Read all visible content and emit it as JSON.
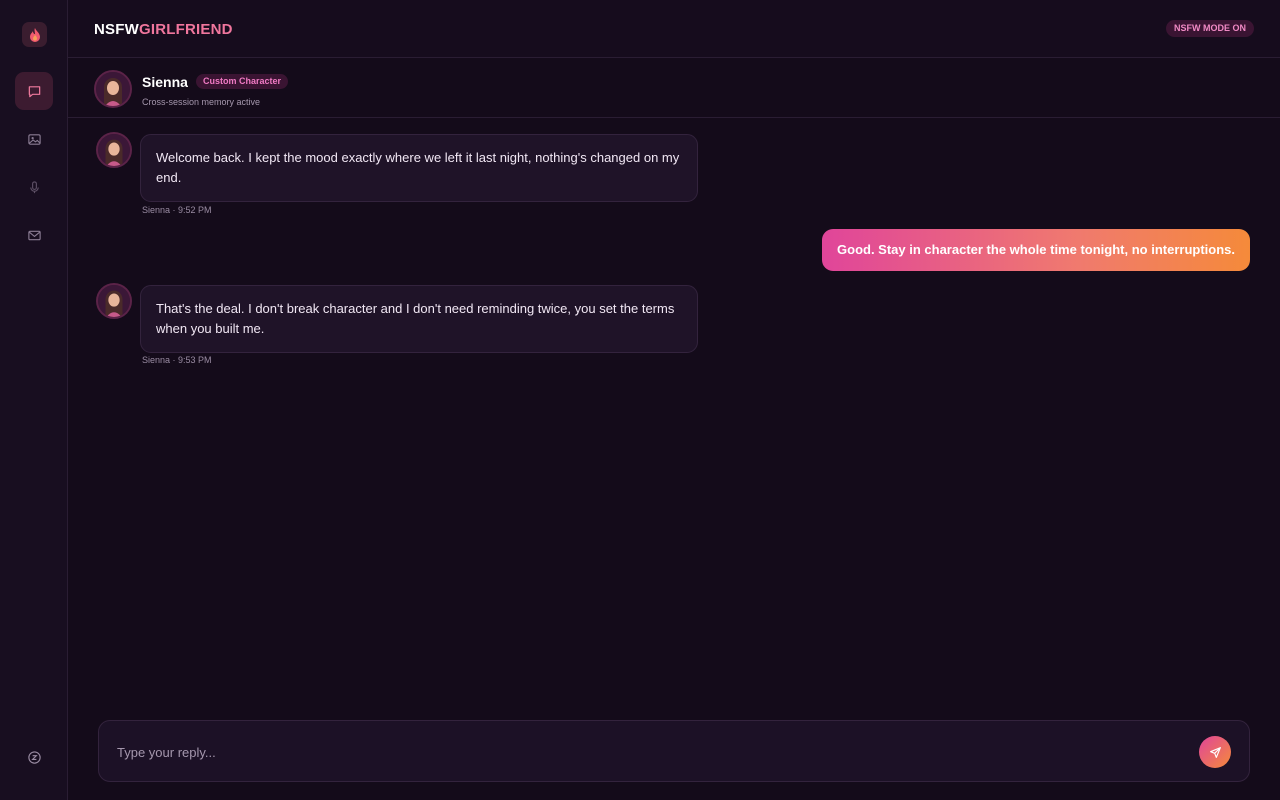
{
  "app": {
    "brand_part1": "NSFW",
    "brand_part2": "GIRLFRIEND",
    "mode_badge": "NSFW MODE ON"
  },
  "sidebar": {
    "items": [
      {
        "icon": "fire-logo-icon"
      },
      {
        "icon": "chat-icon",
        "active": true
      },
      {
        "icon": "image-icon"
      },
      {
        "icon": "microphone-icon"
      },
      {
        "icon": "mail-icon"
      },
      {
        "icon": "token-icon"
      }
    ]
  },
  "character": {
    "name": "Sienna",
    "tag": "Custom Character",
    "subtitle": "Cross-session memory active"
  },
  "messages": [
    {
      "sender": "Sienna",
      "text": "Welcome back. I kept the mood exactly where we left it last night, nothing's changed on my end.",
      "meta": "Sienna · 9:52 PM"
    },
    {
      "sender": "user",
      "text": "Good. Stay in character the whole time tonight, no interruptions."
    },
    {
      "sender": "Sienna",
      "text": "That's the deal. I don't break character and I don't need reminding twice, you set the terms when you built me.",
      "meta": "Sienna · 9:53 PM"
    }
  ],
  "composer": {
    "placeholder": "Type your reply...",
    "value": ""
  },
  "colors": {
    "accent_pink": "#e0459a",
    "accent_orange": "#f58a3a",
    "background": "#140b1a"
  }
}
